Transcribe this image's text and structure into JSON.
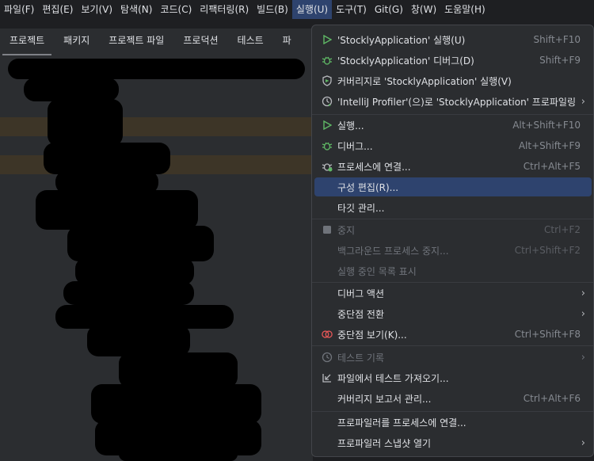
{
  "menubar": {
    "items": [
      "파일(F)",
      "편집(E)",
      "보기(V)",
      "탐색(N)",
      "코드(C)",
      "리팩터링(R)",
      "빌드(B)",
      "실행(U)",
      "도구(T)",
      "Git(G)",
      "창(W)",
      "도움말(H)"
    ],
    "active_index": 7
  },
  "tabs": [
    "프로젝트",
    "패키지",
    "프로젝트 파일",
    "프로덕션",
    "테스트",
    "파"
  ],
  "run_menu": {
    "items": [
      {
        "label": "'StocklyApplication' 실행(U)",
        "shortcut": "Shift+F10",
        "icon": "run-icon"
      },
      {
        "label": "'StocklyApplication' 디버그(D)",
        "shortcut": "Shift+F9",
        "icon": "debug-icon"
      },
      {
        "label": "커버리지로 'StocklyApplication' 실행(V)",
        "shortcut": "",
        "icon": "coverage-icon"
      },
      {
        "label": "'IntelliJ Profiler'(으)로  'StocklyApplication' 프로파일링",
        "shortcut": "",
        "icon": "profiler-icon",
        "submenu": true
      },
      {
        "label": "실행...",
        "shortcut": "Alt+Shift+F10",
        "icon": "run-icon"
      },
      {
        "label": "디버그...",
        "shortcut": "Alt+Shift+F9",
        "icon": "debug-icon"
      },
      {
        "label": "프로세스에 연결...",
        "shortcut": "Ctrl+Alt+F5",
        "icon": "attach-debug-icon"
      },
      {
        "label": "구성 편집(R)...",
        "shortcut": "",
        "icon": ""
      },
      {
        "label": "타깃 관리...",
        "shortcut": "",
        "icon": ""
      },
      {
        "label": "중지",
        "shortcut": "Ctrl+F2",
        "icon": "stop-icon",
        "disabled": true
      },
      {
        "label": "백그라운드 프로세스 중지...",
        "shortcut": "Ctrl+Shift+F2",
        "icon": "",
        "disabled": true
      },
      {
        "label": "실행 중인 목록 표시",
        "shortcut": "",
        "icon": "",
        "disabled": true
      },
      {
        "label": "디버그 액션",
        "shortcut": "",
        "icon": "",
        "submenu": true
      },
      {
        "label": "중단점 전환",
        "shortcut": "",
        "icon": "",
        "submenu": true
      },
      {
        "label": "중단점 보기(K)...",
        "shortcut": "Ctrl+Shift+F8",
        "icon": "breakpoints-icon"
      },
      {
        "label": "테스트 기록",
        "shortcut": "",
        "icon": "history-icon",
        "disabled": true,
        "submenu": true
      },
      {
        "label": "파일에서 테스트 가져오기...",
        "shortcut": "",
        "icon": "import-icon"
      },
      {
        "label": "커버리지 보고서 관리...",
        "shortcut": "Ctrl+Alt+F6",
        "icon": ""
      },
      {
        "label": "프로파일러를 프로세스에 연결...",
        "shortcut": "",
        "icon": ""
      },
      {
        "label": "프로파일러 스냅샷 열기",
        "shortcut": "",
        "icon": "",
        "submenu": true
      }
    ],
    "selected_index": 7
  },
  "colors": {
    "accent": "#2e436e",
    "run_green": "#5fb865",
    "breakpoint_red": "#e55757"
  }
}
